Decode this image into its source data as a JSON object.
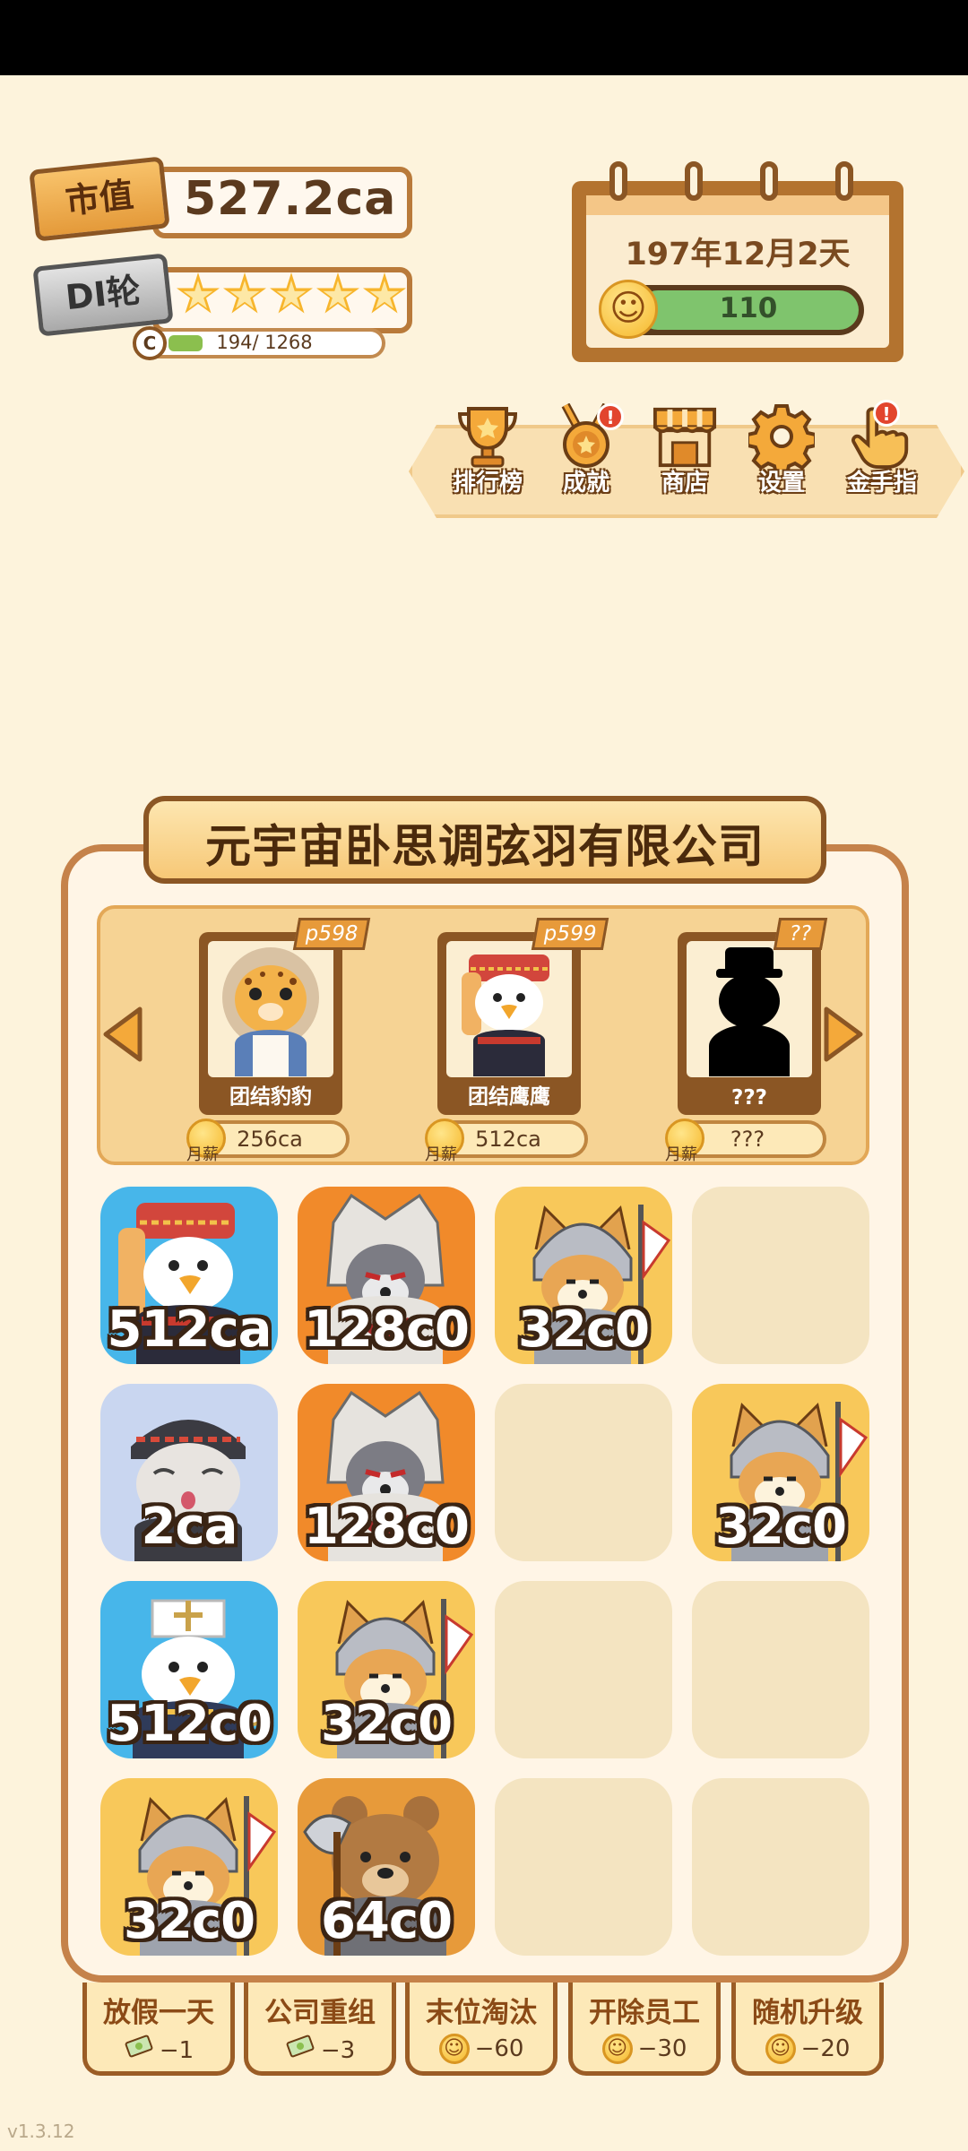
{
  "hud": {
    "market_value_label": "市值",
    "market_value": "527.2ca",
    "rank_label": "DI轮",
    "stars": 5,
    "progress_letter": "C",
    "progress_current": "194",
    "progress_total": "1268",
    "progress_fraction": 0.153
  },
  "calendar": {
    "date": "197年12月2天",
    "mood_value": "110"
  },
  "menu": [
    {
      "label": "排行榜",
      "icon": "trophy-icon",
      "alert": false
    },
    {
      "label": "成就",
      "icon": "medal-icon",
      "alert": true
    },
    {
      "label": "商店",
      "icon": "shop-icon",
      "alert": false
    },
    {
      "label": "设置",
      "icon": "gear-icon",
      "alert": false
    },
    {
      "label": "金手指",
      "icon": "pointing-hand-icon",
      "alert": true
    }
  ],
  "alert_mark": "!",
  "company": {
    "name": "元宇宙卧思调弦羽有限公司"
  },
  "candidates": [
    {
      "tag": "p598",
      "name": "团结豹豹",
      "salary": "256ca",
      "salary_label": "月薪"
    },
    {
      "tag": "p599",
      "name": "团结鹰鹰",
      "salary": "512ca",
      "salary_label": "月薪"
    },
    {
      "tag": "??",
      "name": "???",
      "salary": "???",
      "salary_label": "月薪"
    }
  ],
  "grid": [
    {
      "label": "512ca",
      "bg": "#47b6ea",
      "animal": "eagle"
    },
    {
      "label": "128c0",
      "bg": "#f18a2a",
      "animal": "wolf"
    },
    {
      "label": "32c0",
      "bg": "#f8c85a",
      "animal": "shiba"
    },
    {
      "label": "",
      "bg": "",
      "animal": ""
    },
    {
      "label": "2ca",
      "bg": "#c9d6f0",
      "animal": "hamster"
    },
    {
      "label": "128c0",
      "bg": "#f18a2a",
      "animal": "wolf"
    },
    {
      "label": "",
      "bg": "",
      "animal": ""
    },
    {
      "label": "32c0",
      "bg": "#f8c85a",
      "animal": "shiba"
    },
    {
      "label": "512c0",
      "bg": "#47b6ea",
      "animal": "eagle-white"
    },
    {
      "label": "32c0",
      "bg": "#f8c85a",
      "animal": "shiba"
    },
    {
      "label": "",
      "bg": "",
      "animal": ""
    },
    {
      "label": "",
      "bg": "",
      "animal": ""
    },
    {
      "label": "32c0",
      "bg": "#f8c85a",
      "animal": "shiba"
    },
    {
      "label": "64c0",
      "bg": "#e79a3a",
      "animal": "bear"
    },
    {
      "label": "",
      "bg": "",
      "animal": ""
    },
    {
      "label": "",
      "bg": "",
      "animal": ""
    }
  ],
  "actions": [
    {
      "label": "放假一天",
      "cost": "−1",
      "cost_icon": "money-icon"
    },
    {
      "label": "公司重组",
      "cost": "−3",
      "cost_icon": "money-icon"
    },
    {
      "label": "末位淘汰",
      "cost": "−60",
      "cost_icon": "smile-icon"
    },
    {
      "label": "开除员工",
      "cost": "−30",
      "cost_icon": "smile-icon"
    },
    {
      "label": "随机升级",
      "cost": "−20",
      "cost_icon": "smile-icon"
    }
  ],
  "version": "v1.3.12"
}
